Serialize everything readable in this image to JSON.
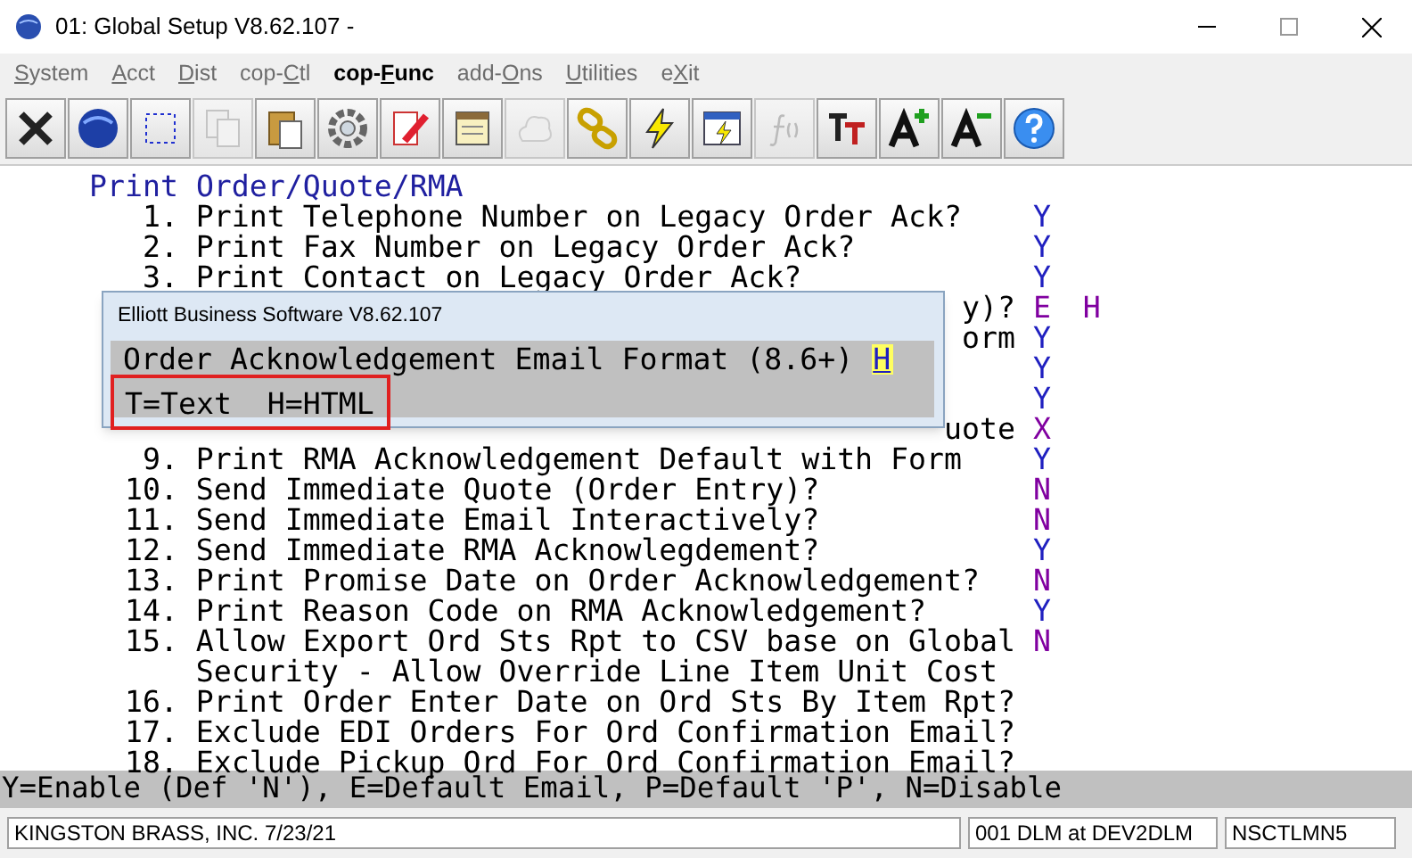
{
  "window": {
    "title": "01: Global Setup V8.62.107 -"
  },
  "menu": [
    {
      "key": "S",
      "post": "ystem",
      "selected": false
    },
    {
      "key": "A",
      "post": "cct",
      "selected": false
    },
    {
      "key": "D",
      "post": "ist",
      "selected": false
    },
    {
      "pre": "cop-",
      "key": "C",
      "post": "tl",
      "selected": false
    },
    {
      "pre": "cop-",
      "key": "F",
      "post": "unc",
      "selected": true
    },
    {
      "pre": "add-",
      "key": "O",
      "post": "ns",
      "selected": false
    },
    {
      "key": "U",
      "post": "tilities",
      "selected": false
    },
    {
      "pre": "e",
      "key": "X",
      "post": "it",
      "selected": false
    }
  ],
  "toolbar": [
    {
      "kind": "close",
      "disabled": false
    },
    {
      "kind": "globe",
      "disabled": false
    },
    {
      "kind": "select",
      "disabled": false
    },
    {
      "kind": "copy",
      "disabled": true
    },
    {
      "kind": "paste",
      "disabled": false
    },
    {
      "kind": "gear",
      "disabled": false
    },
    {
      "kind": "edit",
      "disabled": false
    },
    {
      "kind": "notes",
      "disabled": false
    },
    {
      "kind": "cloud",
      "disabled": true
    },
    {
      "kind": "link",
      "disabled": false
    },
    {
      "kind": "bolt",
      "disabled": false
    },
    {
      "kind": "window",
      "disabled": false
    },
    {
      "kind": "fx",
      "disabled": true
    },
    {
      "kind": "font",
      "disabled": false
    },
    {
      "kind": "grow",
      "disabled": false
    },
    {
      "kind": "shrink",
      "disabled": false
    },
    {
      "kind": "help",
      "disabled": false
    }
  ],
  "screen": {
    "heading": "Print Order/Quote/RMA",
    "rows": [
      {
        "kind": "full",
        "number": "1.",
        "text": "Print Telephone Number on Legacy Order Ack?",
        "value": "Y",
        "color": "#2020c0"
      },
      {
        "kind": "full",
        "number": "2.",
        "text": "Print Fax Number on Legacy Order Ack?",
        "value": "Y",
        "color": "#2020c0"
      },
      {
        "kind": "full",
        "number": "3.",
        "text": "Print Contact on Legacy Order Ack?",
        "value": "Y",
        "color": "#2020c0"
      },
      {
        "kind": "partial",
        "text": "y)?",
        "value": "E",
        "color": "#8000a0",
        "extra": "H"
      },
      {
        "kind": "partial",
        "text": "orm",
        "value": "Y",
        "color": "#2020c0"
      },
      {
        "kind": "partial",
        "value": "Y",
        "color": "#2020c0"
      },
      {
        "kind": "partial",
        "value": "Y",
        "color": "#2020c0"
      },
      {
        "kind": "partial",
        "text": "uote",
        "value": "X",
        "color": "#8000a0"
      },
      {
        "kind": "full",
        "number": "9.",
        "text": "Print RMA Acknowledgement Default with Form",
        "value": "Y",
        "color": "#2020c0"
      },
      {
        "kind": "full",
        "number": "10.",
        "text": "Send Immediate Quote (Order Entry)?",
        "value": "N",
        "color": "#8000a0"
      },
      {
        "kind": "full",
        "number": "11.",
        "text": "Send Immediate Email Interactively?",
        "value": "N",
        "color": "#8000a0"
      },
      {
        "kind": "full",
        "number": "12.",
        "text": "Send Immediate RMA Acknowlegdement?",
        "value": "Y",
        "color": "#2020c0"
      },
      {
        "kind": "full",
        "number": "13.",
        "text": "Print Promise Date on Order Acknowledgement?",
        "value": "N",
        "color": "#8000a0"
      },
      {
        "kind": "full",
        "number": "14.",
        "text": "Print Reason Code on RMA Acknowledgement?",
        "value": "Y",
        "color": "#2020c0"
      },
      {
        "kind": "full",
        "number": "15.",
        "text": "Allow Export Ord Sts Rpt to CSV base on Global Security - Allow Override Line Item Unit Cost",
        "value": "N",
        "color": "#8000a0"
      },
      {
        "kind": "full",
        "number": "16.",
        "text": "Print Order Enter Date on Ord Sts By Item Rpt?"
      },
      {
        "kind": "full",
        "number": "17.",
        "text": "Exclude EDI Orders For Ord Confirmation Email?"
      },
      {
        "kind": "full",
        "number": "18.",
        "text": "Exclude Pickup Ord For Ord Confirmation Email?"
      }
    ]
  },
  "dialog": {
    "title": "Elliott Business Software V8.62.107",
    "prompt": "Order Acknowledgement Email Format (8.6+)",
    "value": "H",
    "hint": "T=Text  H=HTML"
  },
  "hint_bar": "Y=Enable (Def 'N'), E=Default Email, P=Default 'P', N=Disable",
  "status_bar": [
    "KINGSTON BRASS, INC. 7/23/21",
    "001 DLM at DEV2DLM",
    "NSCTLMN5"
  ]
}
